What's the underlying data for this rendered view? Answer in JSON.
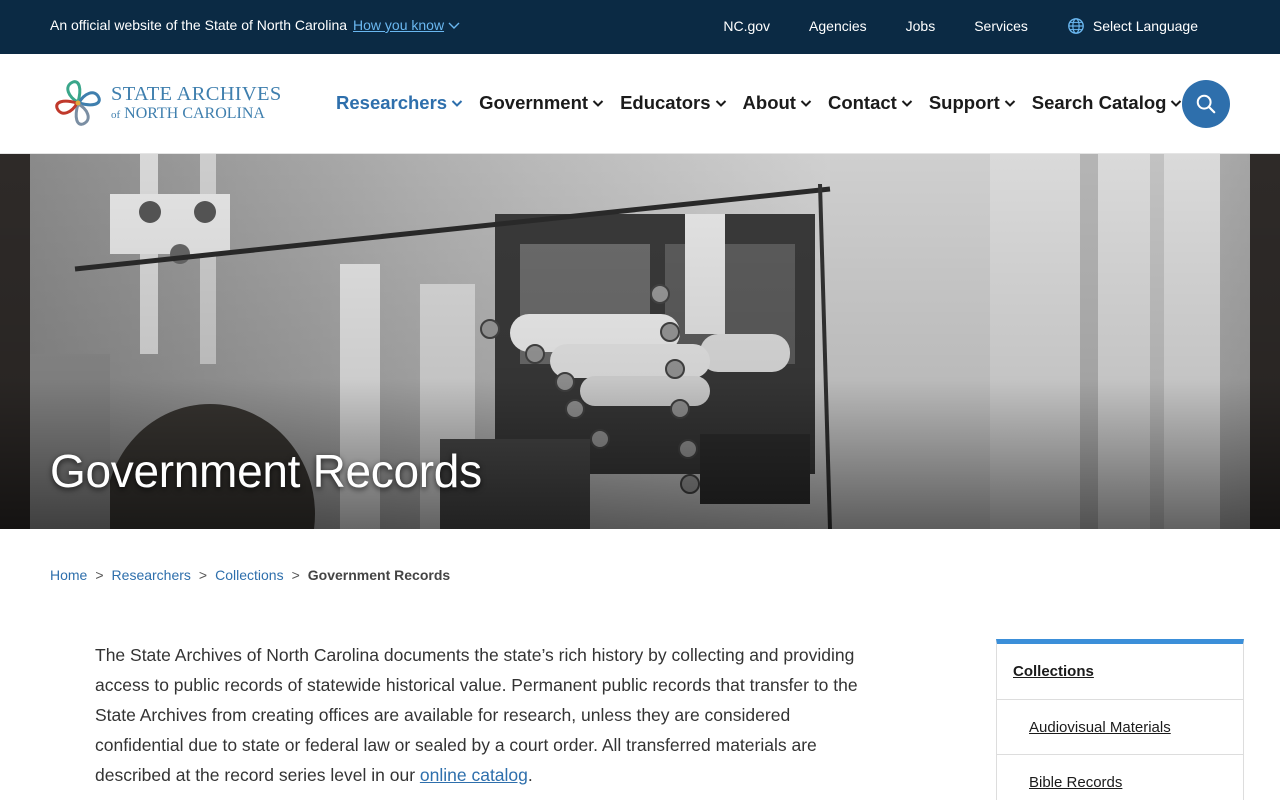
{
  "topbar": {
    "official_text": "An official website of the State of North Carolina",
    "how_you_know": "How you know",
    "links": [
      "NC.gov",
      "Agencies",
      "Jobs",
      "Services"
    ],
    "language": "Select Language"
  },
  "logo": {
    "line1": "STATE ARCHIVES",
    "line2_of": "of",
    "line2": "NORTH CAROLINA"
  },
  "nav": {
    "items": [
      "Researchers",
      "Government",
      "Educators",
      "About",
      "Contact",
      "Support",
      "Search Catalog"
    ],
    "active": "Researchers"
  },
  "hero": {
    "title": "Government Records"
  },
  "breadcrumb": {
    "items": [
      "Home",
      "Researchers",
      "Collections"
    ],
    "separator": ">",
    "current": "Government Records"
  },
  "intro": {
    "text_before": "The State Archives of North Carolina documents the state’s rich history by collecting and providing access to public records of statewide historical value. Permanent public records that transfer to the State Archives from creating offices are available for research, unless they are considered confidential due to state or federal law or sealed by a court order. All transferred materials are described at the record series level in our ",
    "link": "online catalog",
    "text_after": "."
  },
  "sidenav": {
    "heading": "Collections",
    "items": [
      "Audiovisual Materials",
      "Bible Records"
    ]
  },
  "colors": {
    "topbar_bg": "#0b2a44",
    "accent": "#2e6fac",
    "sidenav_border": "#3b8fd9"
  }
}
